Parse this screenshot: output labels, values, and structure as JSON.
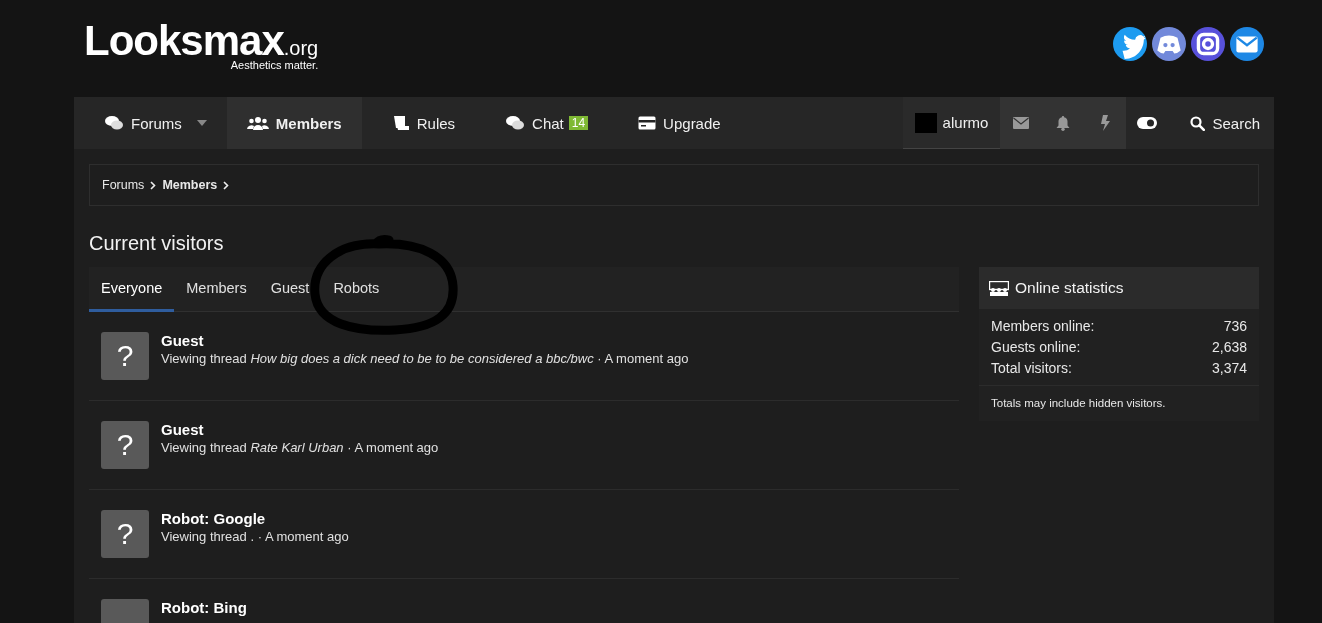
{
  "logo": {
    "name": "Looksmax",
    "suffix": ".org",
    "tagline": "Aesthetics matter."
  },
  "social": [
    {
      "kind": "twitter",
      "color": "#1d9bf0"
    },
    {
      "kind": "discord",
      "color": "#7289da"
    },
    {
      "kind": "instagram",
      "color": "#5851db"
    },
    {
      "kind": "email",
      "color": "#1e88e5"
    }
  ],
  "nav": {
    "items": [
      {
        "kind": "forums",
        "label": "Forums",
        "selected": false,
        "dropdown": true
      },
      {
        "kind": "members",
        "label": "Members",
        "selected": true,
        "dropdown": false
      },
      {
        "kind": "rules",
        "label": "Rules",
        "selected": false,
        "dropdown": false
      },
      {
        "kind": "chat",
        "label": "Chat",
        "selected": false,
        "dropdown": false,
        "badge": "14"
      },
      {
        "kind": "upgrade",
        "label": "Upgrade",
        "selected": false,
        "dropdown": false
      }
    ],
    "user": {
      "name": "alurmo"
    },
    "search": "Search"
  },
  "breadcrumb": [
    "Forums",
    "Members"
  ],
  "title": "Current visitors",
  "tabs": [
    {
      "label": "Everyone",
      "selected": true
    },
    {
      "label": "Members",
      "selected": false
    },
    {
      "label": "Guest",
      "selected": false
    },
    {
      "label": "Robots",
      "selected": false
    }
  ],
  "visitors": [
    {
      "avatar": "?",
      "name": "Guest",
      "action": "Viewing thread",
      "thread": "How big does a dick need to be to be considered a bbc/bwc",
      "separator": "·",
      "time": "A moment ago"
    },
    {
      "avatar": "?",
      "name": "Guest",
      "action": "Viewing thread",
      "thread": "Rate Karl Urban",
      "separator": "·",
      "time": "A moment ago"
    },
    {
      "avatar": "?",
      "name": "Robot: Google",
      "action": "Viewing thread .",
      "separator": "·",
      "time": "A moment ago"
    },
    {
      "name": "Robot: Bing"
    }
  ],
  "stats": {
    "title": "Online statistics",
    "rows": [
      {
        "label": "Members online:",
        "value": "736"
      },
      {
        "label": "Guests online:",
        "value": "2,638"
      },
      {
        "label": "Total visitors:",
        "value": "3,374"
      }
    ],
    "note": "Totals may include hidden visitors."
  }
}
